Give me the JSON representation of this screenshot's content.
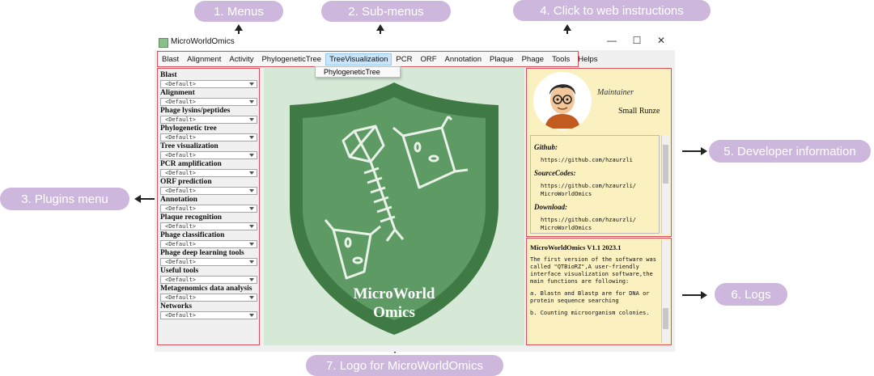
{
  "callouts": {
    "menus": "1. Menus",
    "submenus": "2. Sub-menus",
    "plugins": "3. Plugins menu",
    "web": "4. Click to web instructions",
    "developer": "5. Developer information",
    "logs": "6. Logs",
    "logo": "7. Logo for MicroWorldOmics"
  },
  "window": {
    "title": "MicroWorldOmics",
    "controls": {
      "minimize": "—",
      "maximize": "☐",
      "close": "✕"
    }
  },
  "menubar": {
    "items": [
      "Blast",
      "Alignment",
      "Activity",
      "PhylogeneticTree",
      "TreeVisualization",
      "PCR",
      "ORF",
      "Annotation",
      "Plaque",
      "Phage",
      "Tools",
      "Helps"
    ],
    "active_index": 4
  },
  "submenu": {
    "item": "PhylogeneticTree"
  },
  "plugins": [
    {
      "title": "Blast",
      "value": "<Default>"
    },
    {
      "title": "Alignment",
      "value": "<Default>"
    },
    {
      "title": "Phage lysins/peptides",
      "value": "<Default>"
    },
    {
      "title": "Phylogenetic tree",
      "value": "<Default>"
    },
    {
      "title": "Tree visualization",
      "value": "<Default>"
    },
    {
      "title": "PCR amplification",
      "value": "<Default>"
    },
    {
      "title": "ORF prediction",
      "value": "<Default>"
    },
    {
      "title": "Annotation",
      "value": "<Default>"
    },
    {
      "title": "Plaque recognition",
      "value": "<Default>"
    },
    {
      "title": "Phage classification",
      "value": "<Default>"
    },
    {
      "title": "Phage deep learning tools",
      "value": "<Default>"
    },
    {
      "title": "Useful tools",
      "value": "<Default>"
    },
    {
      "title": "Metagenomics data analysis",
      "value": "<Default>"
    },
    {
      "title": "Networks",
      "value": "<Default>"
    }
  ],
  "logo": {
    "line1": "MicroWorld",
    "line2": "Omics"
  },
  "developer": {
    "role": "Maintainer",
    "name": "Small Runze",
    "github_label": "Github:",
    "github_url": "https://github.com/hzaurzli",
    "source_label": "SourceCodes:",
    "source_url": "https://github.com/hzaurzli/ MicroWorldOmics",
    "download_label": "Download:",
    "download_url": "https://github.com/hzaurzli/ MicroWorldOmics"
  },
  "logs": {
    "version": "MicroWorldOmics V1.1 2023.1",
    "para1": "The first version of the software was called \"QTBioRZ\",A user-friendly interface visualization software,the main functions are following:",
    "para2": "a. Blastn and Blastp are for DNA or protein sequence searching",
    "para3": "b. Counting microorganism colonies."
  },
  "colors": {
    "callout_bg": "#cdb7dc",
    "highlight_border": "#d9505c",
    "shield_dark": "#3f7a45",
    "shield_light": "#5e9a63",
    "panel_yellow": "#fbf0c0",
    "center_bg": "#d5e9d6"
  }
}
